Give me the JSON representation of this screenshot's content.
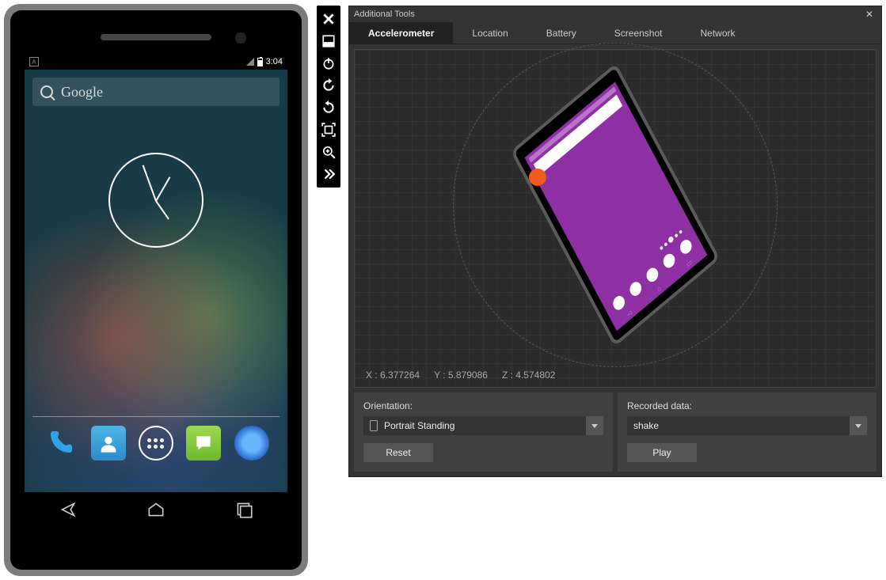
{
  "emulator": {
    "status_indicator": "A",
    "time": "3:04",
    "search_placeholder": "Google"
  },
  "toolbar": {
    "items": [
      "close",
      "minimize",
      "power",
      "rotate-left",
      "rotate-right",
      "fit",
      "zoom",
      "more"
    ]
  },
  "panel": {
    "title": "Additional Tools",
    "tabs": [
      "Accelerometer",
      "Location",
      "Battery",
      "Screenshot",
      "Network"
    ],
    "active_tab": "Accelerometer",
    "coords": {
      "x_label": "X :",
      "x": "6.377264",
      "y_label": "Y :",
      "y": "5.879086",
      "z_label": "Z :",
      "z": "4.574802"
    },
    "orientation": {
      "label": "Orientation:",
      "value": "Portrait Standing",
      "button": "Reset"
    },
    "recorded": {
      "label": "Recorded data:",
      "value": "shake",
      "button": "Play"
    }
  }
}
